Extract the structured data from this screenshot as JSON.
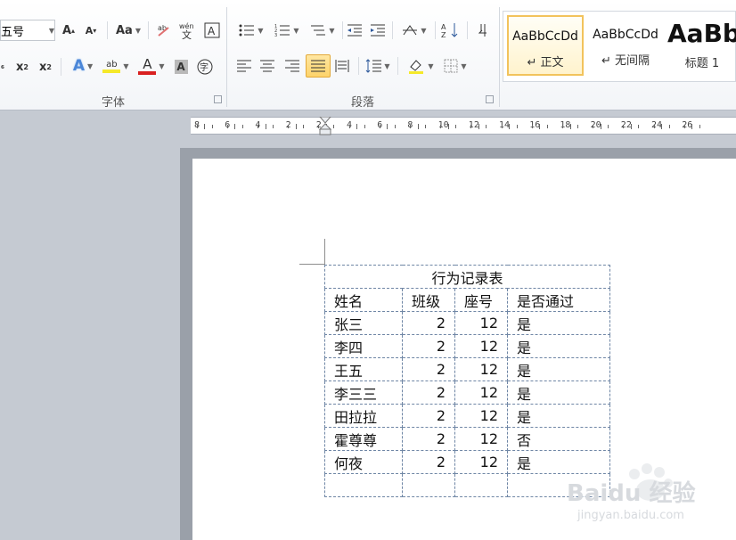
{
  "ribbon": {
    "font_size_value": "五号",
    "groups": {
      "font_label": "字体",
      "paragraph_label": "段落"
    },
    "styles": [
      {
        "preview": "AaBbCcDd",
        "name": "↵ 正文",
        "selected": true
      },
      {
        "preview": "AaBbCcDd",
        "name": "↵ 无间隔",
        "selected": false
      },
      {
        "preview": "AaBb",
        "name": "标题 1",
        "selected": false
      }
    ],
    "colors": {
      "highlight": "#f5e92a",
      "font_color": "#d92020",
      "accent": "#2b579a"
    }
  },
  "ruler": {
    "labels": [
      "8",
      "6",
      "4",
      "2",
      "2",
      "4",
      "6",
      "8",
      "10",
      "12",
      "14",
      "16",
      "18",
      "20",
      "22",
      "24",
      "26"
    ]
  },
  "table": {
    "title": "行为记录表",
    "headers": [
      "姓名",
      "班级",
      "座号",
      "是否通过"
    ],
    "rows": [
      [
        "张三",
        "2",
        "12",
        "是"
      ],
      [
        "李四",
        "2",
        "12",
        "是"
      ],
      [
        "王五",
        "2",
        "12",
        "是"
      ],
      [
        "李三三",
        "2",
        "12",
        "是"
      ],
      [
        "田拉拉",
        "2",
        "12",
        "是"
      ],
      [
        "霍尊尊",
        "2",
        "12",
        "否"
      ],
      [
        "何夜",
        "2",
        "12",
        "是"
      ],
      [
        "",
        "",
        "",
        ""
      ]
    ]
  },
  "watermark": {
    "brand": "Baidu 经验",
    "url": "jingyan.baidu.com"
  }
}
